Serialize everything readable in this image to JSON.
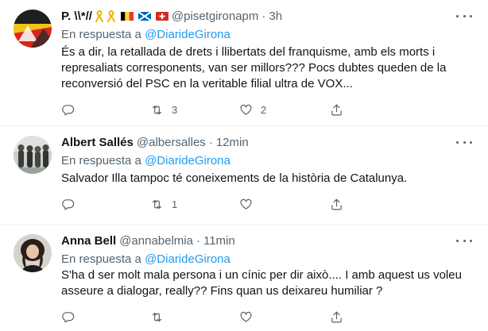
{
  "tweets": [
    {
      "name": "P. \\\\*//",
      "emojis": [
        "yellow-ribbon",
        "yellow-ribbon",
        "belgium-flag",
        "scotland-flag",
        "swiss-flag"
      ],
      "handle": "@pisetgironapm",
      "sep": "·",
      "time": "3h",
      "reply_prefix": "En respuesta a",
      "reply_handle": "@DiarideGirona",
      "text": "És a dir, la retallada de drets i llibertats del franquisme, amb els morts i represaliats corresponents, van ser millors??? Pocs dubtes queden de la reconversió del PSC en la veritable filial ultra de VOX...",
      "replies": "",
      "retweets": "3",
      "likes": "2"
    },
    {
      "name": "Albert Sallés",
      "handle": "@albersalles",
      "sep": "·",
      "time": "12min",
      "reply_prefix": "En respuesta a",
      "reply_handle": "@DiarideGirona",
      "text": "Salvador Illa tampoc té coneixements de la història de Catalunya.",
      "replies": "",
      "retweets": "1",
      "likes": ""
    },
    {
      "name": "Anna Bell",
      "handle": "@annabelmia",
      "sep": "·",
      "time": "11min",
      "reply_prefix": "En respuesta a",
      "reply_handle": "@DiarideGirona",
      "text": "S'ha d ser molt mala persona i un cínic per dir això.... I amb aquest us voleu asseure a dialogar, really?? Fins quan us deixareu humiliar ?",
      "replies": "",
      "retweets": "",
      "likes": ""
    }
  ],
  "colors": {
    "link": "#1d9bf0",
    "secondary_text": "#536471",
    "primary_text": "#0f1419",
    "divider": "#eff3f4"
  }
}
